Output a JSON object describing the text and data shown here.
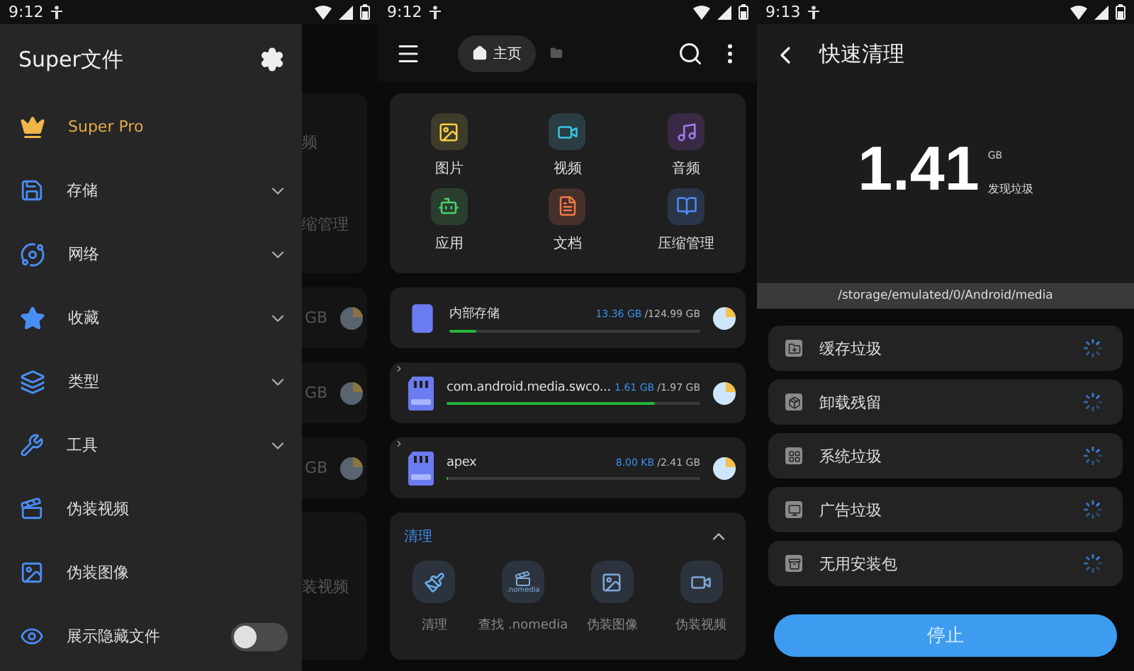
{
  "drawer_screen": {
    "status_bar": {
      "time": "9:12"
    },
    "drawer": {
      "title": "Super文件",
      "items": [
        {
          "kind": "pro",
          "label": "Super Pro"
        },
        {
          "kind": "expandable",
          "label": "存储",
          "expanded": false
        },
        {
          "kind": "expandable",
          "label": "网络",
          "expanded": false
        },
        {
          "kind": "expandable",
          "label": "收藏",
          "expanded": false
        },
        {
          "kind": "expandable",
          "label": "类型",
          "expanded": false
        },
        {
          "kind": "expandable",
          "label": "工具",
          "expanded": false
        },
        {
          "kind": "link",
          "label": "伪装视频"
        },
        {
          "kind": "link",
          "label": "伪装图像"
        },
        {
          "kind": "toggle",
          "label": "展示隐藏文件",
          "on": false
        }
      ]
    },
    "backdrop": {
      "category_labels": [
        "频",
        "缩管理"
      ],
      "storage_sizes": [
        "GB",
        "GB",
        "GB"
      ],
      "tool_label": "装视频"
    }
  },
  "home_screen": {
    "status_bar": {
      "time": "9:12"
    },
    "breadcrumb": "主页",
    "categories": [
      {
        "kind": "image",
        "label": "图片"
      },
      {
        "kind": "video",
        "label": "视频"
      },
      {
        "kind": "audio",
        "label": "音频"
      },
      {
        "kind": "app",
        "label": "应用"
      },
      {
        "kind": "doc",
        "label": "文档"
      },
      {
        "kind": "archive",
        "label": "压缩管理"
      }
    ],
    "storages": [
      {
        "kind": "phone",
        "name": "内部存储",
        "used": "13.36 GB",
        "total": "/124.99 GB",
        "level": 0.11,
        "expandable": false
      },
      {
        "kind": "sd",
        "name": "com.android.media.swco...",
        "used": "1.61 GB",
        "total": "/1.97 GB",
        "level": 0.82,
        "expandable": true
      },
      {
        "kind": "sd",
        "name": "apex",
        "used": "8.00 KB",
        "total": "/2.41 GB",
        "level": 0,
        "expandable": true
      }
    ],
    "clean_section": {
      "title": "清理",
      "expanded": true,
      "tools": [
        {
          "kind": "broom",
          "label": "清理"
        },
        {
          "kind": "nomedia",
          "icon_text": ".nomedia",
          "label": "查找 .nomedia"
        },
        {
          "kind": "image",
          "label": "伪装图像"
        },
        {
          "kind": "video",
          "label": "伪装视频"
        }
      ]
    }
  },
  "clean_screen": {
    "status_bar": {
      "time": "9:13"
    },
    "title": "快速清理",
    "amount": "1.41",
    "unit": "GB",
    "caption": "发现垃圾",
    "path": "/storage/emulated/0/Android/media",
    "items": [
      {
        "kind": "cache",
        "label": "缓存垃圾",
        "scanning": true
      },
      {
        "kind": "residual",
        "label": "卸载残留",
        "scanning": true
      },
      {
        "kind": "system",
        "label": "系统垃圾",
        "scanning": true
      },
      {
        "kind": "ads",
        "label": "广告垃圾",
        "scanning": true
      },
      {
        "kind": "apk",
        "label": "无用安装包",
        "scanning": true
      }
    ],
    "button": "停止"
  }
}
